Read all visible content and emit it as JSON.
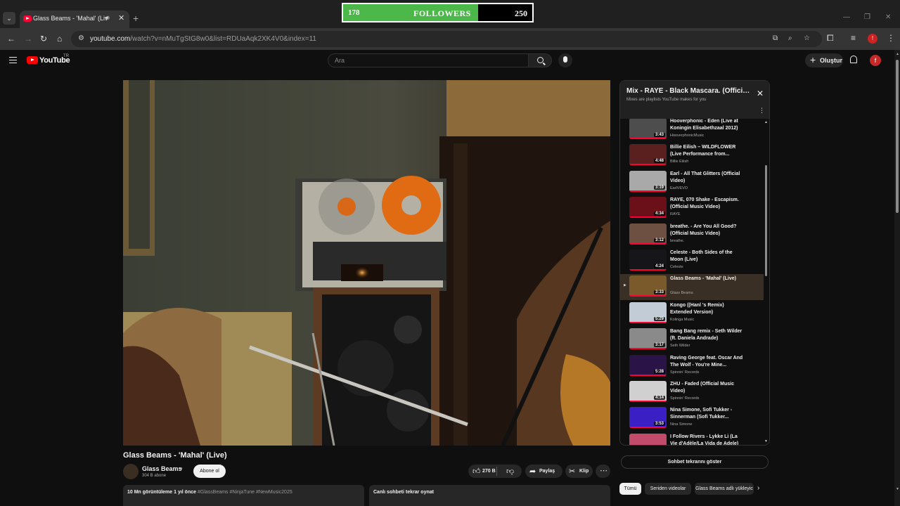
{
  "browser": {
    "tab_title": "Glass Beams - 'Mahal' (Liv",
    "url_host": "youtube.com",
    "url_path": "/watch?v=nMuTgStG8w0&list=RDUaAqk2XK4V0&index=11",
    "profile_initial": "!"
  },
  "followers_widget": {
    "current": "178",
    "label": "FOLLOWERS",
    "goal": "250",
    "progress_fraction": 0.712,
    "fill_color": "#4cb84a"
  },
  "youtube": {
    "wordmark": "YouTube",
    "region": "TR",
    "search_placeholder": "Ara",
    "create_label": "Oluştur",
    "avatar_initial": "f"
  },
  "video": {
    "title": "Glass Beams - 'Mahal' (Live)",
    "channel": "Glass Beams",
    "subscribers": "304 B abone",
    "subscribe_label": "Abone ol",
    "likes": "270 B",
    "share_label": "Paylaş",
    "clip_label": "Klip",
    "views_time": "10 Mn görüntüleme  1 yıl önce",
    "hashtags": "#GlassBeams #NinjaTune #NewMusic2025",
    "replay_chat": "Canlı sohbeti tekrar oynat"
  },
  "playlist": {
    "title": "Mix - RAYE - Black Mascara. (Official Music Video)",
    "subtitle": "Mixes are playlists YouTube makes for you",
    "items": [
      {
        "title": "Hooverphonic - Eden (Live at Koningin Elisabethzaal 2012)",
        "channel": "HooverphonicMusic",
        "duration": "3:43",
        "color": "#4d4d4d",
        "active": false
      },
      {
        "title": "Billie Eilish – WILDFLOWER (Live Performance from...",
        "channel": "Billie Eilish",
        "duration": "4:48",
        "color": "#5a1f1f",
        "active": false
      },
      {
        "title": "Earl - All That Glitters (Official Video)",
        "channel": "EarlVEVO",
        "duration": "3:19",
        "color": "#a9a9a9",
        "active": false
      },
      {
        "title": "RAYE, 070 Shake - Escapism. (Official Music Video)",
        "channel": "RAYE",
        "duration": "4:34",
        "color": "#6b0f18",
        "active": false
      },
      {
        "title": "breathe. - Are You All Good? (Official Music Video)",
        "channel": "breathe.",
        "duration": "3:12",
        "color": "#6e5042",
        "active": false
      },
      {
        "title": "Celeste - Both Sides of the Moon (Live)",
        "channel": "Celeste",
        "duration": "4:24",
        "color": "#15151a",
        "active": false
      },
      {
        "title": "Glass Beams - 'Mahal' (Live)",
        "channel": "Glass Beams",
        "duration": "3:33",
        "color": "#7a5a2a",
        "active": true
      },
      {
        "title": "Kongo ((Hanl 's Remix) Extended Version)",
        "channel": "Kolinga Music",
        "duration": "5:29",
        "color": "#c2ccd6",
        "active": false
      },
      {
        "title": "Bang Bang remix - Seth Wilder (ft. Daniela Andrade)",
        "channel": "Seth Wilder",
        "duration": "3:17",
        "color": "#8a8a8a",
        "active": false
      },
      {
        "title": "Raving George feat. Oscar And The Wolf - You're Mine...",
        "channel": "Spinnin' Records",
        "duration": "5:28",
        "color": "#2a1447",
        "active": false
      },
      {
        "title": "ZHU - Faded (Official Music Video)",
        "channel": "Spinnin' Records",
        "duration": "4:14",
        "color": "#d0d0d0",
        "active": false
      },
      {
        "title": "Nina Simone, Sofi Tukker - Sinnerman (Sofi Tukker...",
        "channel": "Nina Simone",
        "duration": "3:53",
        "color": "#3a1fc4",
        "active": false
      },
      {
        "title": "I Follow Rivers - Lykke Li (La Vie d'Adèle/La Vida de Adele)",
        "channel": "Abla Zurna",
        "duration": "4:44",
        "color": "#c24a6a",
        "active": false
      }
    ]
  },
  "below_playlist": {
    "chat_button": "Sohbet tekrarını göster",
    "chips": [
      "Tümü",
      "Seriden videolar",
      "Glass Beams adlı yükleyic"
    ]
  }
}
